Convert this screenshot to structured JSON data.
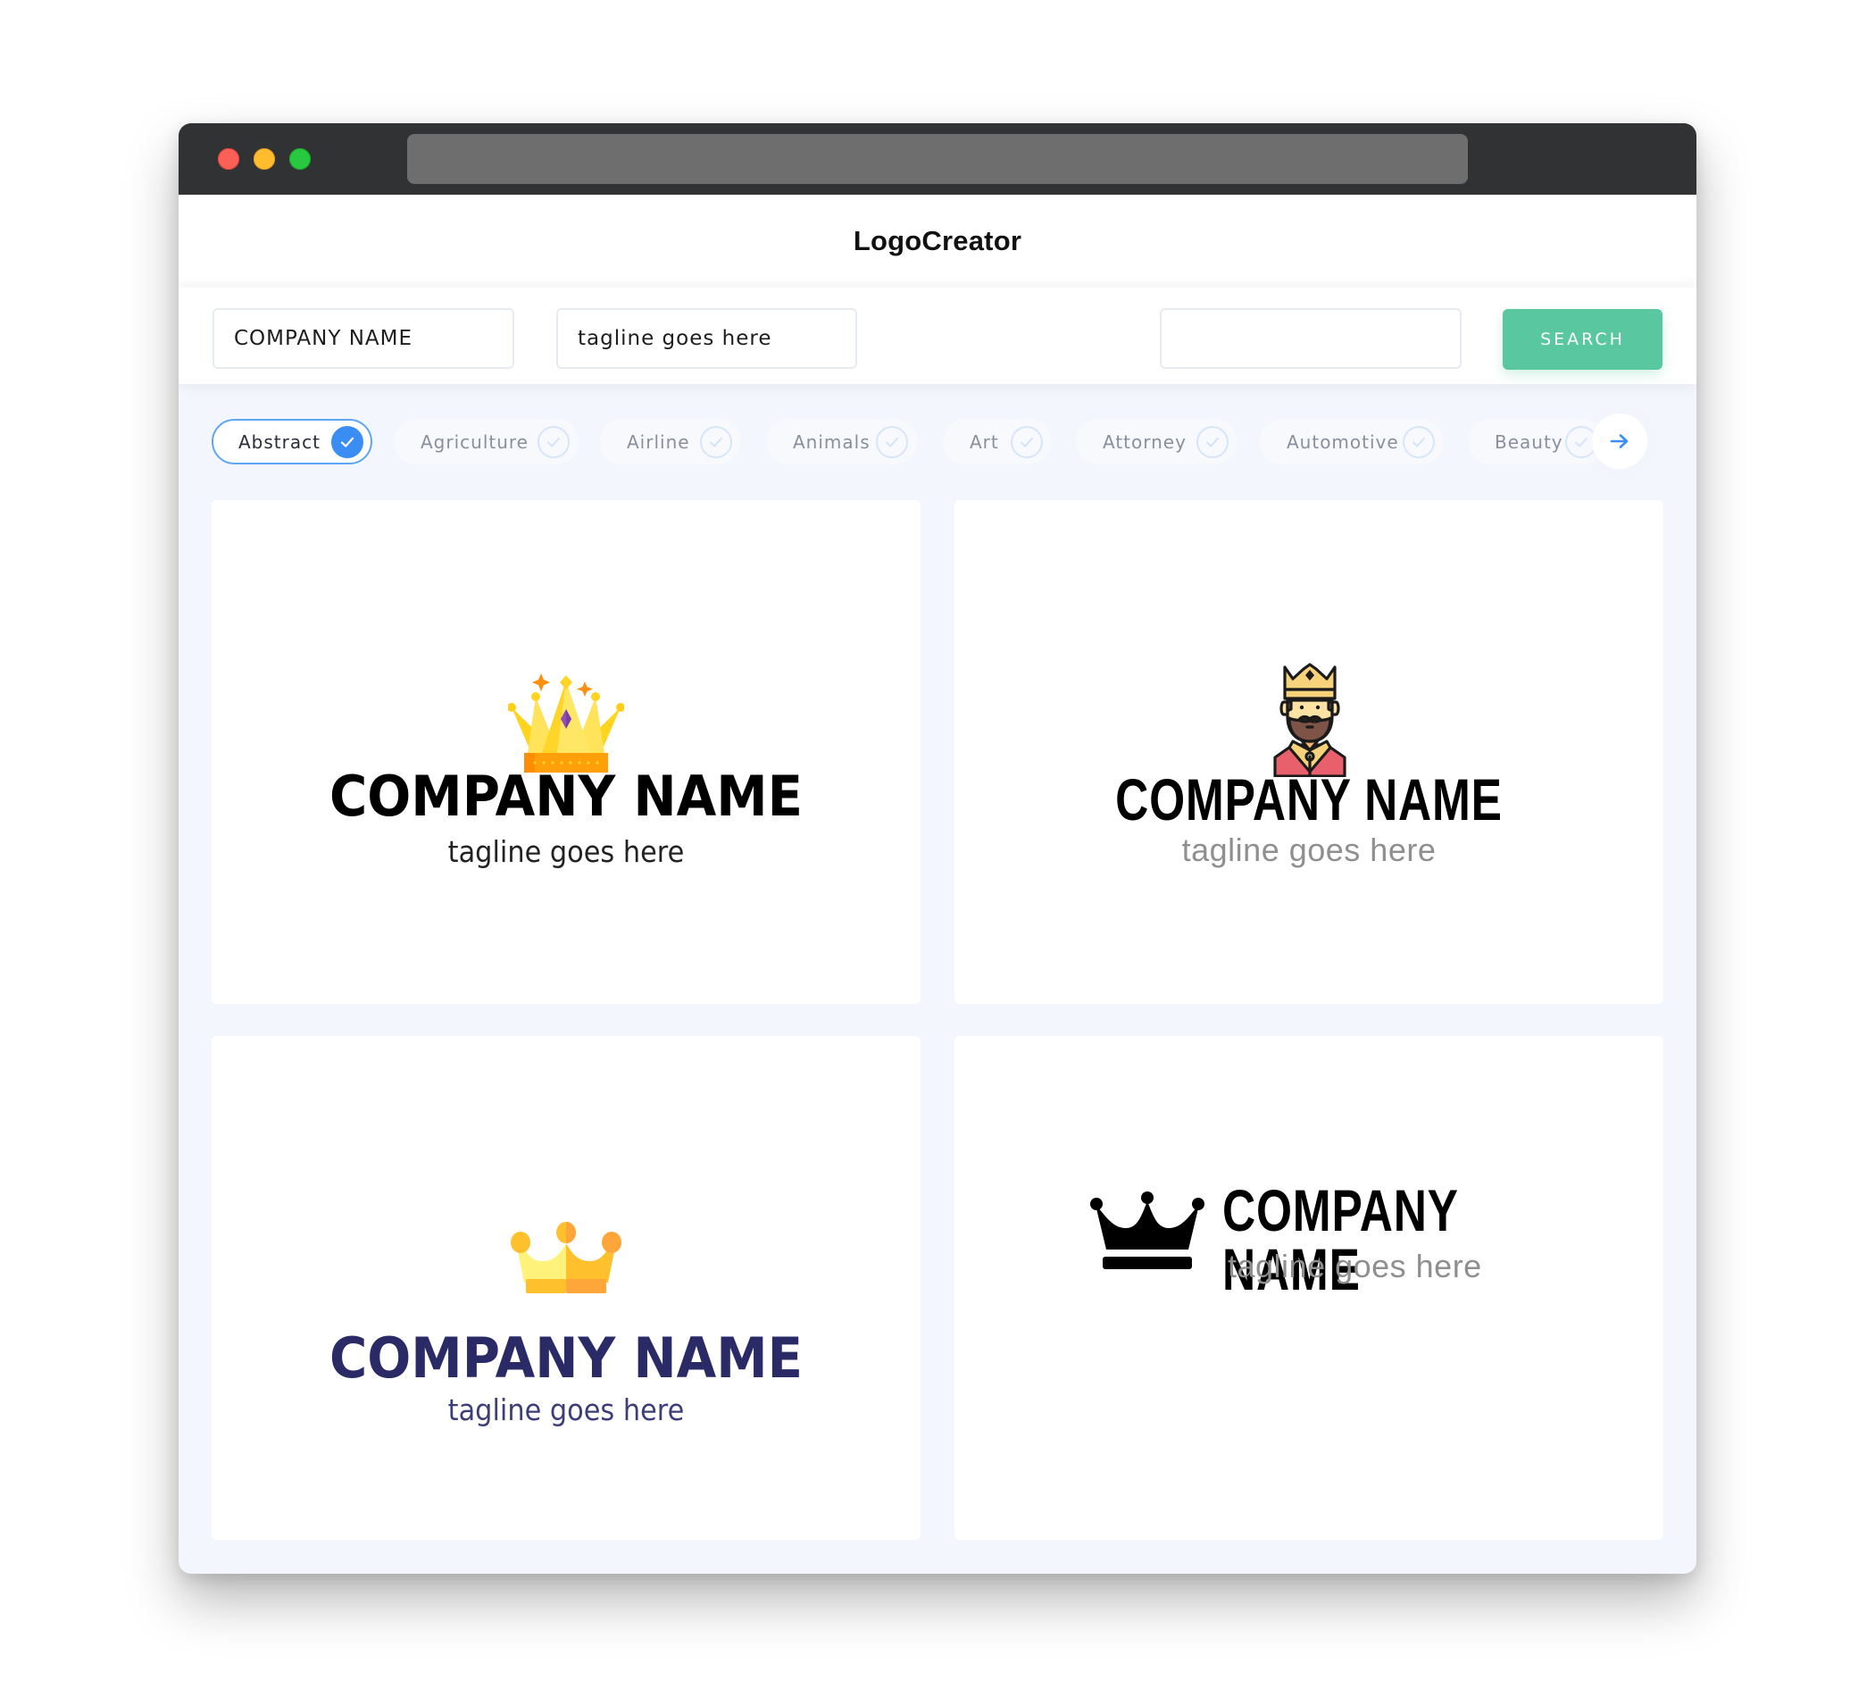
{
  "window": {
    "controls": [
      "close",
      "minimize",
      "maximize"
    ],
    "url": ""
  },
  "header": {
    "brand": "LogoCreator"
  },
  "search": {
    "company_name_value": "COMPANY NAME",
    "tagline_value": "tagline goes here",
    "keyword_value": "",
    "button_label": "SEARCH"
  },
  "categories": {
    "items": [
      {
        "label": "Abstract",
        "selected": true
      },
      {
        "label": "Agriculture",
        "selected": false
      },
      {
        "label": "Airline",
        "selected": false
      },
      {
        "label": "Animals",
        "selected": false
      },
      {
        "label": "Art",
        "selected": false
      },
      {
        "label": "Attorney",
        "selected": false
      },
      {
        "label": "Automotive",
        "selected": false
      },
      {
        "label": "Beauty",
        "selected": false
      }
    ],
    "next_icon": "arrow-right-icon"
  },
  "colors": {
    "accent_green": "#59c8a0",
    "accent_blue": "#3a8ef3",
    "navy_text": "#2a2a66",
    "coral_red": "#e8606c"
  },
  "logos": [
    {
      "icon": "gold-crown-with-gem-icon",
      "name": "COMPANY NAME",
      "tagline": "tagline goes here",
      "layout": "stacked",
      "name_color": "#000000",
      "tagline_color": "#222222"
    },
    {
      "icon": "king-avatar-icon",
      "name": "COMPANY NAME",
      "tagline": "tagline goes here",
      "layout": "stacked",
      "name_color": "#000000",
      "tagline_color": "#8f8f8f"
    },
    {
      "icon": "flat-crown-icon",
      "name": "COMPANY NAME",
      "tagline": "tagline goes here",
      "layout": "stacked",
      "name_color": "#2a2a66",
      "tagline_color": "#3d3d78"
    },
    {
      "icon": "black-crown-icon",
      "name": "COMPANY NAME",
      "tagline": "tagline goes here",
      "layout": "inline",
      "name_color": "#000000",
      "tagline_color": "#8f8f8f"
    }
  ]
}
